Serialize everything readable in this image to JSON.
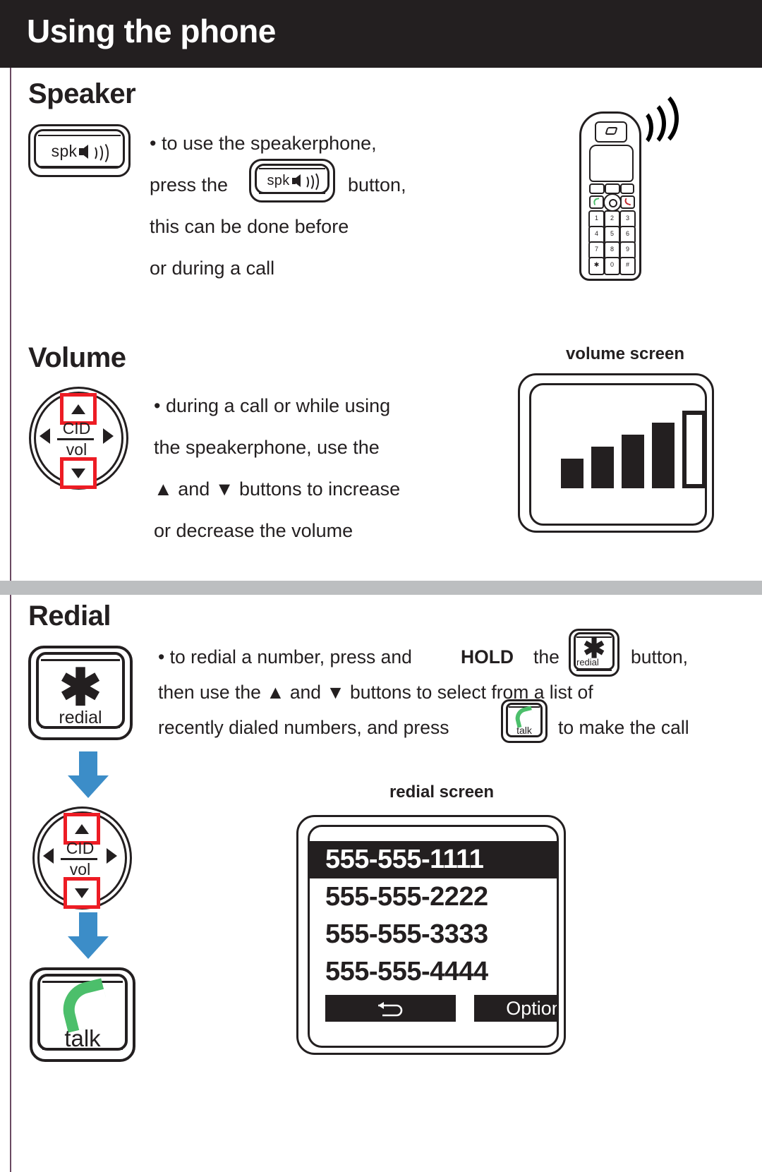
{
  "header": {
    "title": "Using the phone"
  },
  "sections": {
    "speaker": {
      "title": "Speaker",
      "key_label": "spk",
      "lines": [
        "• to use the speakerphone,",
        "press the",
        "button,",
        "this can be done before",
        "or during a call"
      ]
    },
    "volume": {
      "title": "Volume",
      "wheel": {
        "cid": "CID",
        "vol": "vol"
      },
      "lines": [
        "• during a call or while using",
        "the speakerphone, use the",
        "▲ and ▼ buttons to increase",
        "or decrease the volume"
      ],
      "screen_caption": "volume screen"
    },
    "redial": {
      "title": "Redial",
      "key_star": "✱",
      "key_label": "redial",
      "talk_label": "talk",
      "wheel": {
        "cid": "CID",
        "vol": "vol"
      },
      "line1_a": "• to redial a number, press and",
      "line1_hold": "HOLD",
      "line1_b": "the",
      "line1_c": "button,",
      "line2": "then use the ▲ and ▼ buttons to select from a list of",
      "line3_a": "recently dialed numbers, and press",
      "line3_b": "to make the call",
      "screen_caption": "redial screen",
      "numbers": [
        "555-555-1111",
        "555-555-2222",
        "555-555-3333",
        "555-555-4444"
      ],
      "selected_index": 0,
      "softkeys": {
        "back": "↰",
        "option": "Option"
      }
    }
  },
  "colors": {
    "header_bg": "#231f20",
    "ink": "#231f20",
    "highlight_red": "#ed1c24",
    "arrow_blue": "#3c8dc8",
    "handset_green": "#4cbf6b",
    "divider_grey": "#bcbec0"
  },
  "chart_data": {
    "type": "bar",
    "title": "volume screen",
    "categories": [
      "1",
      "2",
      "3",
      "4",
      "5"
    ],
    "values": [
      1,
      2,
      3,
      4,
      5
    ],
    "xlabel": "",
    "ylabel": "",
    "ylim": [
      0,
      5
    ],
    "notes": "Five-step volume level indicator; bars 1-4 filled solid, bar 5 hollow outline (current level = 4 of 5)"
  }
}
